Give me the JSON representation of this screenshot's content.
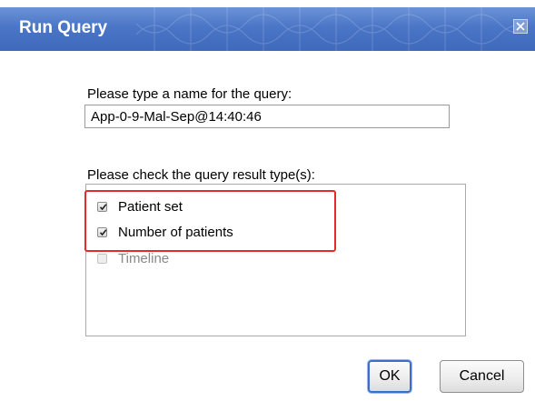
{
  "dialog": {
    "title": "Run Query",
    "close_icon": "close-icon"
  },
  "name_field": {
    "label": "Please type a name for the query:",
    "value": "App-0-9-Mal-Sep@14:40:46"
  },
  "result_types": {
    "label": "Please check the query result type(s):",
    "options": [
      {
        "label": "Patient set",
        "checked": true,
        "enabled": true
      },
      {
        "label": "Number of patients",
        "checked": true,
        "enabled": true
      },
      {
        "label": "Timeline",
        "checked": false,
        "enabled": false
      }
    ]
  },
  "buttons": {
    "ok_label": "OK",
    "cancel_label": "Cancel"
  },
  "colors": {
    "titlebar": "#4b76c6",
    "highlight": "#e32b2b",
    "ok_border": "#3a6fc9"
  }
}
